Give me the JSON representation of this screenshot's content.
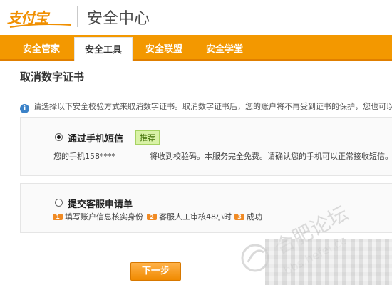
{
  "header": {
    "logo_text": "支付宝",
    "title": "安全中心"
  },
  "nav": {
    "items": [
      {
        "label": "安全管家"
      },
      {
        "label": "安全工具"
      },
      {
        "label": "安全联盟"
      },
      {
        "label": "安全学堂"
      }
    ],
    "active_index": 1
  },
  "page": {
    "title": "取消数字证书",
    "notice_icon": "info-icon",
    "notice": "请选择以下安全校验方式来取消数字证书。取消数字证书后，您的账户将不再受到证书的保护，您也可以"
  },
  "options": {
    "sms": {
      "label": "通过手机短信",
      "badge": "推荐",
      "desc_prefix": "您的手机158****",
      "desc_suffix": "将收到校验码。本服务完全免费。请确认您的手机可以正常接收短信。",
      "selected": true
    },
    "service": {
      "label": "提交客服申请单",
      "selected": false,
      "steps": [
        {
          "tag": "1",
          "text": "填写账户信息核实身份"
        },
        {
          "tag": "2",
          "text": "客服人工审核48小时"
        },
        {
          "tag": "3",
          "text": "成功"
        }
      ]
    }
  },
  "actions": {
    "next_label": "下一步"
  },
  "watermark": {
    "text1": "合肥论坛",
    "text2": "bbs.hefei.cc"
  },
  "colors": {
    "brand_orange": "#f39800",
    "badge_green": "#d9f2a6",
    "info_blue": "#3b82c8"
  }
}
